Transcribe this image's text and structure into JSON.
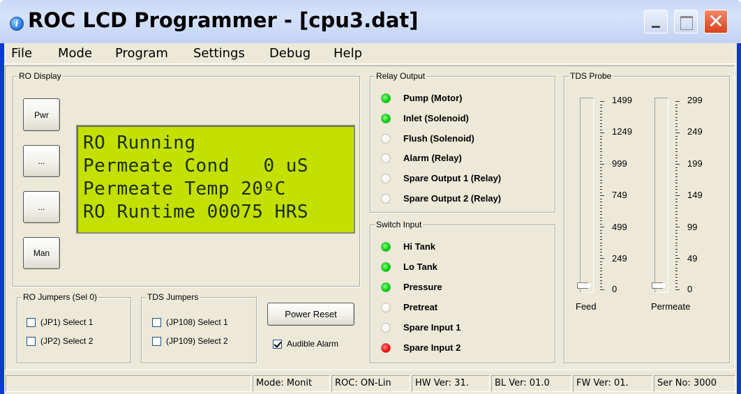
{
  "window": {
    "title": "ROC LCD Programmer - [cpu3.dat]",
    "close_glyph": "✕"
  },
  "menu": {
    "items": [
      "File",
      "Mode",
      "Program",
      "Settings",
      "Debug",
      "Help"
    ]
  },
  "ro_display": {
    "title": "RO Display",
    "buttons": [
      "Pwr",
      "...",
      "...",
      "Man"
    ],
    "lcd_lines": [
      "RO Running",
      "Permeate Cond   0 uS",
      "Permeate Temp 20ºC",
      "RO Runtime 00075 HRS"
    ],
    "lcd_color": "#c3e000"
  },
  "ro_jumpers": {
    "title": "RO Jumpers (Sel 0)",
    "items": [
      {
        "label": "(JP1) Select 1",
        "checked": false
      },
      {
        "label": "(JP2) Select 2",
        "checked": false
      }
    ]
  },
  "tds_jumpers": {
    "title": "TDS Jumpers",
    "items": [
      {
        "label": "(JP108) Select 1",
        "checked": false
      },
      {
        "label": "(JP109) Select 2",
        "checked": false
      }
    ]
  },
  "power_reset_label": "Power Reset",
  "audible_alarm": {
    "label": "Audible Alarm",
    "checked": true
  },
  "relay_output": {
    "title": "Relay Output",
    "items": [
      {
        "label": "Pump (Motor)",
        "state": "green"
      },
      {
        "label": "Inlet (Solenoid)",
        "state": "green"
      },
      {
        "label": "Flush (Solenoid)",
        "state": "off"
      },
      {
        "label": "Alarm (Relay)",
        "state": "off"
      },
      {
        "label": "Spare Output 1 (Relay)",
        "state": "off"
      },
      {
        "label": "Spare Output 2 (Relay)",
        "state": "off"
      }
    ]
  },
  "switch_input": {
    "title": "Switch Input",
    "items": [
      {
        "label": "Hi Tank",
        "state": "green"
      },
      {
        "label": "Lo Tank",
        "state": "green"
      },
      {
        "label": "Pressure",
        "state": "green"
      },
      {
        "label": "Pretreat",
        "state": "off"
      },
      {
        "label": "Spare Input 1",
        "state": "off"
      },
      {
        "label": "Spare Input 2",
        "state": "red"
      }
    ]
  },
  "tds_probe": {
    "title": "TDS Probe",
    "feed": {
      "label": "Feed",
      "scale": [
        "1499",
        "1249",
        "999",
        "749",
        "499",
        "249",
        "0"
      ],
      "value": 0
    },
    "permeate": {
      "label": "Permeate",
      "scale": [
        "299",
        "249",
        "199",
        "149",
        "99",
        "49",
        "0"
      ],
      "value": 0
    }
  },
  "status": {
    "panes": [
      "",
      "Mode: Monit",
      "ROC: ON-Lin",
      "HW Ver: 31.",
      "BL Ver: 01.0",
      "FW Ver: 01.",
      "Ser No: 3000"
    ]
  },
  "colors": {
    "title_bg": "#c9d8f7",
    "face": "#ece9d8",
    "led_green": "#00d000",
    "led_red": "#ff0000"
  }
}
